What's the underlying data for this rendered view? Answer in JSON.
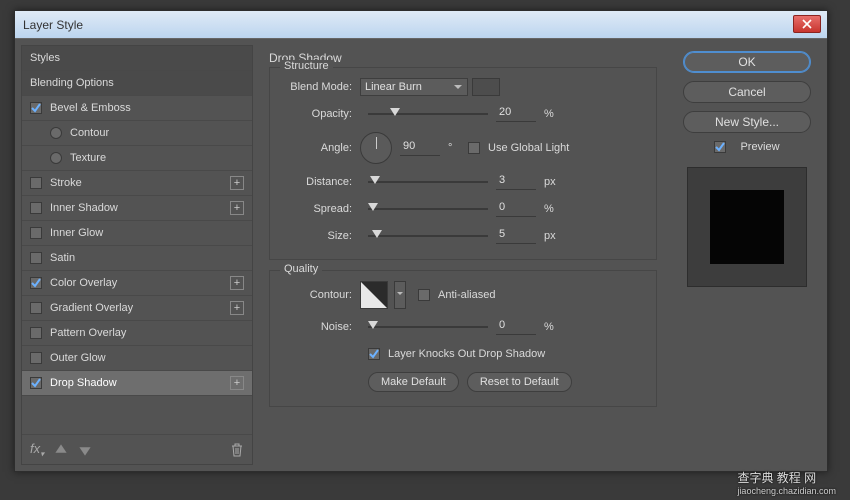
{
  "dialog": {
    "title": "Layer Style"
  },
  "left": {
    "styles_label": "Styles",
    "blending_label": "Blending Options",
    "items": [
      {
        "label": "Bevel & Emboss",
        "checked": true
      },
      {
        "label": "Contour",
        "sub": true
      },
      {
        "label": "Texture",
        "sub": true
      },
      {
        "label": "Stroke",
        "plus": true
      },
      {
        "label": "Inner Shadow",
        "plus": true
      },
      {
        "label": "Inner Glow"
      },
      {
        "label": "Satin"
      },
      {
        "label": "Color Overlay",
        "checked": true,
        "plus": true
      },
      {
        "label": "Gradient Overlay",
        "plus": true
      },
      {
        "label": "Pattern Overlay"
      },
      {
        "label": "Outer Glow"
      },
      {
        "label": "Drop Shadow",
        "checked": true,
        "selected": true,
        "plus": true
      }
    ]
  },
  "center": {
    "title": "Drop Shadow",
    "structure_legend": "Structure",
    "quality_legend": "Quality",
    "blend_mode_label": "Blend Mode:",
    "blend_mode_value": "Linear Burn",
    "opacity_label": "Opacity:",
    "opacity_value": "20",
    "opacity_unit": "%",
    "angle_label": "Angle:",
    "angle_value": "90",
    "angle_unit": "°",
    "global_light_label": "Use Global Light",
    "distance_label": "Distance:",
    "distance_value": "3",
    "distance_unit": "px",
    "spread_label": "Spread:",
    "spread_value": "0",
    "spread_unit": "%",
    "size_label": "Size:",
    "size_value": "5",
    "size_unit": "px",
    "contour_label": "Contour:",
    "antialias_label": "Anti-aliased",
    "noise_label": "Noise:",
    "noise_value": "0",
    "noise_unit": "%",
    "knockout_label": "Layer Knocks Out Drop Shadow",
    "make_default": "Make Default",
    "reset_default": "Reset to Default"
  },
  "right": {
    "ok": "OK",
    "cancel": "Cancel",
    "new_style": "New Style...",
    "preview_label": "Preview"
  },
  "watermark": {
    "main": "查字典 教程 网",
    "sub": "jiaocheng.chazidian.com"
  }
}
